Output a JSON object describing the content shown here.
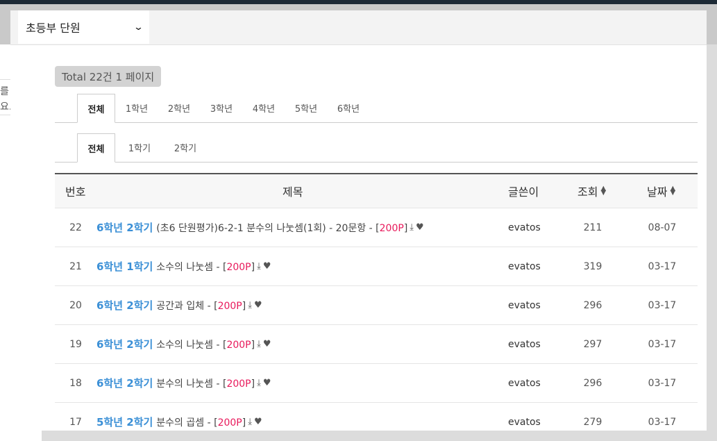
{
  "background": {
    "side_text_1": "를",
    "side_text_2": "요."
  },
  "selector": {
    "value": "초등부 단원"
  },
  "total_label": "Total 22건 1 페이지",
  "grade_tabs": [
    "전체",
    "1학년",
    "2학년",
    "3학년",
    "4학년",
    "5학년",
    "6학년"
  ],
  "semester_tabs": [
    "전체",
    "1학기",
    "2학기"
  ],
  "table": {
    "headers": {
      "num": "번호",
      "title": "제목",
      "author": "글쓴이",
      "views": "조회",
      "date": "날짜"
    },
    "rows": [
      {
        "num": "22",
        "category": "6학년 2학기",
        "subject": "(초6 단원평가)6-2-1 분수의 나눗셈(1회) - 20문항 - [",
        "points": "200P",
        "close": "]",
        "author": "evatos",
        "views": "211",
        "date": "08-07"
      },
      {
        "num": "21",
        "category": "6학년 1학기",
        "subject": "소수의 나눗셈 - [",
        "points": "200P",
        "close": "]",
        "author": "evatos",
        "views": "319",
        "date": "03-17"
      },
      {
        "num": "20",
        "category": "6학년 2학기",
        "subject": "공간과 입체 - [",
        "points": "200P",
        "close": "]",
        "author": "evatos",
        "views": "296",
        "date": "03-17"
      },
      {
        "num": "19",
        "category": "6학년 2학기",
        "subject": "소수의 나눗셈 - [",
        "points": "200P",
        "close": "]",
        "author": "evatos",
        "views": "297",
        "date": "03-17"
      },
      {
        "num": "18",
        "category": "6학년 2학기",
        "subject": "분수의 나눗셈 - [",
        "points": "200P",
        "close": "]",
        "author": "evatos",
        "views": "296",
        "date": "03-17"
      },
      {
        "num": "17",
        "category": "5학년 2학기",
        "subject": "분수의 곱셈 - [",
        "points": "200P",
        "close": "]",
        "author": "evatos",
        "views": "279",
        "date": "03-17"
      }
    ]
  },
  "colors": {
    "category": "#3a8fd6",
    "points": "#e8195b"
  },
  "icons": {
    "download": "download-icon",
    "heart": "heart-icon",
    "sort": "sort-icon",
    "chevron": "chevron-down-icon"
  }
}
